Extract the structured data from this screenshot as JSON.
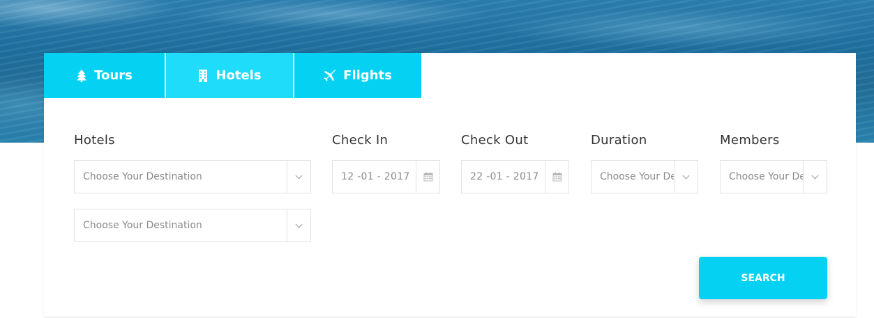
{
  "tabs": [
    {
      "label": "Tours",
      "icon": "tree-icon"
    },
    {
      "label": "Hotels",
      "icon": "building-icon"
    },
    {
      "label": "Flights",
      "icon": "plane-icon"
    }
  ],
  "active_tab": "Hotels",
  "form": {
    "hotels": {
      "label": "Hotels",
      "select1": "Choose Your Destination",
      "select2": "Choose Your Destination"
    },
    "check_in": {
      "label": "Check In",
      "value": "12 -01 - 2017"
    },
    "check_out": {
      "label": "Check Out",
      "value": "22 -01 - 2017"
    },
    "duration": {
      "label": "Duration",
      "value": "Choose Your De"
    },
    "members": {
      "label": "Members",
      "value": "Choose Your De"
    }
  },
  "search_label": "SEARCH",
  "colors": {
    "accent": "#05d1f3",
    "accent_active": "#1fdcfb"
  }
}
